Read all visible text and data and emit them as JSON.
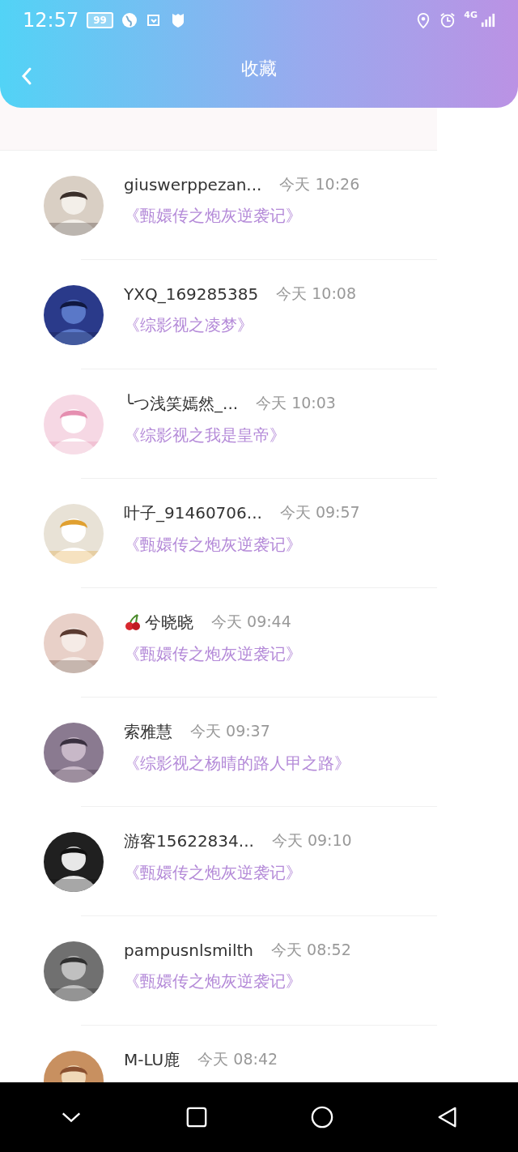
{
  "status_bar": {
    "time": "12:57",
    "battery": "99",
    "network": "4G"
  },
  "header": {
    "title": "收藏"
  },
  "favorites": [
    {
      "name": "giuswerppezan...",
      "time": "今天 10:26",
      "title": "《甄嬛传之炮灰逆袭记》",
      "cherry": false
    },
    {
      "name": "YXQ_169285385",
      "time": "今天 10:08",
      "title": "《综影视之凌梦》",
      "cherry": false
    },
    {
      "name": "╰つ浅笑嫣然_...",
      "time": "今天 10:03",
      "title": "《综影视之我是皇帝》",
      "cherry": false
    },
    {
      "name": "叶子_91460706...",
      "time": "今天 09:57",
      "title": "《甄嬛传之炮灰逆袭记》",
      "cherry": false
    },
    {
      "name": "兮晓晓",
      "time": "今天 09:44",
      "title": "《甄嬛传之炮灰逆袭记》",
      "cherry": true
    },
    {
      "name": "索雅慧",
      "time": "今天 09:37",
      "title": "《综影视之杨晴的路人甲之路》",
      "cherry": false
    },
    {
      "name": "游客15622834...",
      "time": "今天 09:10",
      "title": "《甄嬛传之炮灰逆袭记》",
      "cherry": false
    },
    {
      "name": "pampusnlsmilth",
      "time": "今天 08:52",
      "title": "《甄嬛传之炮灰逆袭记》",
      "cherry": false
    },
    {
      "name": "M-LU鹿",
      "time": "今天 08:42",
      "cherry": false
    }
  ]
}
